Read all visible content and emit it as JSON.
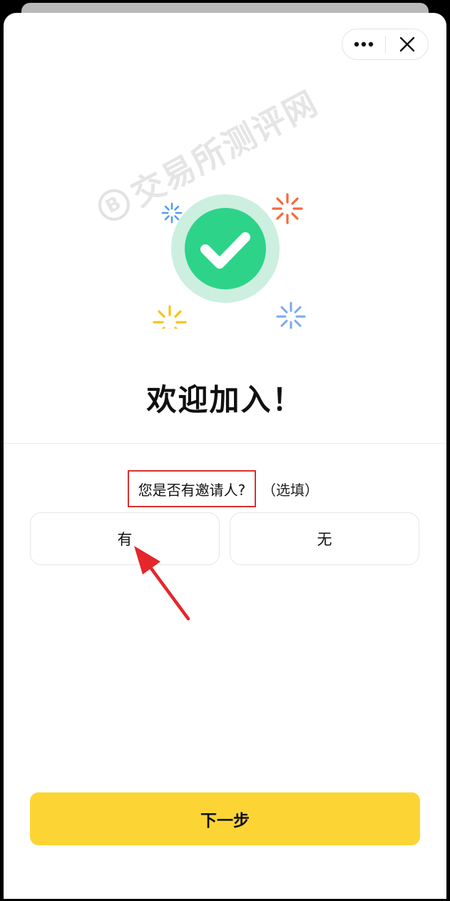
{
  "header": {
    "more_icon": "more-dots-icon",
    "close_icon": "close-x-icon"
  },
  "watermark": {
    "coin": "B",
    "text": "交易所测评网"
  },
  "hero": {
    "icon": "check-circle-icon",
    "accent_color": "#2ed38a",
    "title": "欢迎加入！"
  },
  "question": {
    "label": "您是否有邀请人?",
    "hint": "（选填）"
  },
  "options": [
    {
      "label": "有"
    },
    {
      "label": "无"
    }
  ],
  "footer": {
    "next_label": "下一步",
    "next_color": "#fcd535"
  }
}
